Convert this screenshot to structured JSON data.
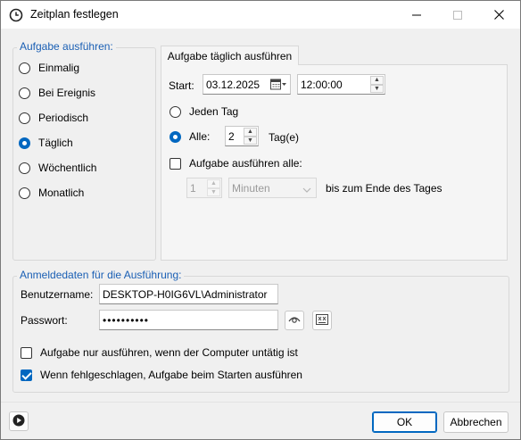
{
  "window": {
    "title": "Zeitplan festlegen",
    "icon": "clock-icon",
    "accent": "#0067c0"
  },
  "task_group": {
    "title": "Aufgabe ausführen:",
    "options": [
      {
        "label": "Einmalig",
        "checked": false
      },
      {
        "label": "Bei Ereignis",
        "checked": false
      },
      {
        "label": "Periodisch",
        "checked": false
      },
      {
        "label": "Täglich",
        "checked": true
      },
      {
        "label": "Wöchentlich",
        "checked": false
      },
      {
        "label": "Monatlich",
        "checked": false
      }
    ]
  },
  "daily_tab": {
    "tab_label": "Aufgabe täglich ausführen",
    "start_label": "Start:",
    "start_date": "03.12.2025",
    "start_time": "12:00:00",
    "every_day_label": "Jeden Tag",
    "every_n_label": "Alle:",
    "every_n_value": "2",
    "every_n_unit": "Tag(e)",
    "repeat_label": "Aufgabe ausführen alle:",
    "repeat_value": "1",
    "repeat_unit": "Minuten",
    "until_label": "bis zum Ende des Tages"
  },
  "credentials": {
    "title": "Anmeldedaten für die Ausführung:",
    "username_label": "Benutzername:",
    "username_value": "DESKTOP-H0IG6VL\\Administrator",
    "password_label": "Passwort:",
    "password_value": "••••••••••",
    "idle_only_label": "Aufgabe nur ausführen, wenn der Computer untätig ist",
    "idle_only_checked": false,
    "run_on_fail_label": "Wenn fehlgeschlagen, Aufgabe beim Starten ausführen",
    "run_on_fail_checked": true
  },
  "footer": {
    "ok_label": "OK",
    "cancel_label": "Abbrechen"
  }
}
